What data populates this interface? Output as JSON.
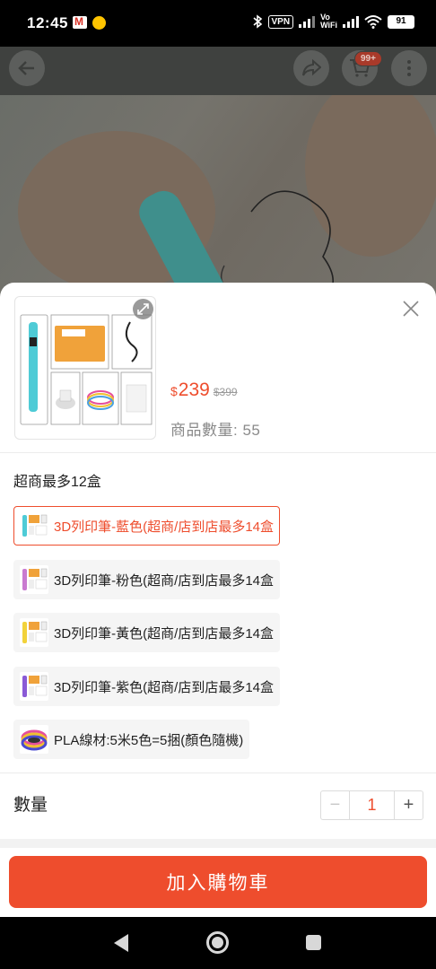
{
  "status_bar": {
    "time": "12:45",
    "vpn": "VPN",
    "vowifi": "Vo\nWiFi",
    "battery": "91"
  },
  "header": {
    "cart_badge": "99+",
    "icons": [
      "back-arrow-icon",
      "share-icon",
      "cart-icon",
      "more-vert-icon"
    ]
  },
  "product": {
    "currency": "$",
    "price": "239",
    "original_price": "$399",
    "stock_text": "商品數量: 55"
  },
  "variations": {
    "limit_text": "超商最多12盒",
    "options": [
      {
        "label": "3D列印筆-藍色(超商/店到店最多14盒",
        "selected": true
      },
      {
        "label": "3D列印筆-粉色(超商/店到店最多14盒",
        "selected": false
      },
      {
        "label": "3D列印筆-黃色(超商/店到店最多14盒",
        "selected": false
      },
      {
        "label": "3D列印筆-紫色(超商/店到店最多14盒",
        "selected": false
      },
      {
        "label": "PLA線材:5米5色=5捆(顏色隨機)",
        "selected": false
      }
    ]
  },
  "quantity": {
    "label": "數量",
    "value": "1",
    "minus": "−",
    "plus": "+"
  },
  "actions": {
    "add_to_cart": "加入購物車"
  },
  "colors": {
    "accent": "#ee4d2d",
    "stock_text": "#8a8a8a"
  }
}
